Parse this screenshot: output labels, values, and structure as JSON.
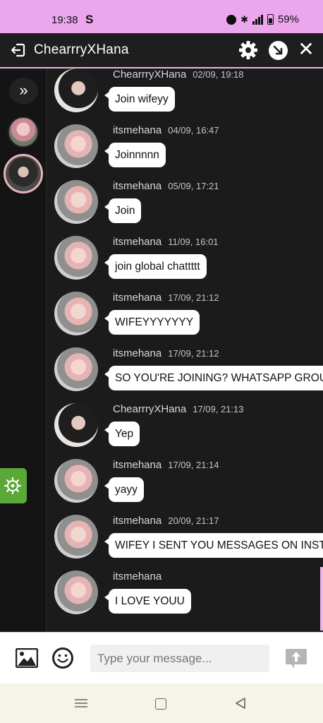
{
  "status_bar": {
    "time": "19:38",
    "app_icon": "S",
    "battery": "59%"
  },
  "header": {
    "title": "ChearrryXHana",
    "icons": [
      "exit-icon",
      "gear-icon",
      "popout-icon",
      "close-icon"
    ]
  },
  "sidebar": {
    "expand_label": "»",
    "icons": [
      "double-chevron-right-icon",
      "gear-icon"
    ]
  },
  "messages": [
    {
      "user": "ChearrryXHana",
      "time": "02/09, 19:18",
      "text": "Join wifeyy"
    },
    {
      "user": "itsmehana",
      "time": "04/09, 16:47",
      "text": "Joinnnnn"
    },
    {
      "user": "itsmehana",
      "time": "05/09, 17:21",
      "text": "Join"
    },
    {
      "user": "itsmehana",
      "time": "11/09, 16:01",
      "text": "join global chattttt"
    },
    {
      "user": "itsmehana",
      "time": "17/09, 21:12",
      "text": "WIFEYYYYYYY"
    },
    {
      "user": "itsmehana",
      "time": "17/09, 21:12",
      "text": "SO YOU'RE JOINING? WHATSAPP GROUP?"
    },
    {
      "user": "ChearrryXHana",
      "time": "17/09, 21:13",
      "text": "Yep"
    },
    {
      "user": "itsmehana",
      "time": "17/09, 21:14",
      "text": "yayy"
    },
    {
      "user": "itsmehana",
      "time": "20/09, 21:17",
      "text": "WIFEY I SENT YOU MESSAGES ON INSTA"
    },
    {
      "user": "itsmehana",
      "time": "",
      "text": "I LOVE YOUU"
    }
  ],
  "input": {
    "placeholder": "Type your message...",
    "value": ""
  },
  "colors": {
    "status_bar_bg": "#eba6ee",
    "accent_pink": "#e9b7e6",
    "settings_green": "#5aa837",
    "chat_bg": "#1b1b1b",
    "bubble_bg": "#ffffff"
  }
}
